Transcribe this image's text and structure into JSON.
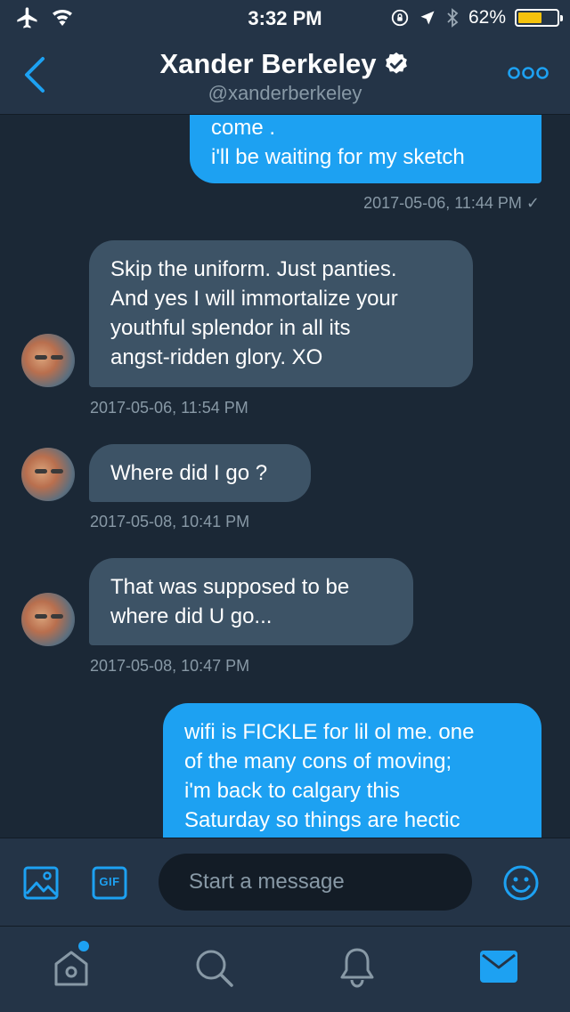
{
  "status_bar": {
    "time": "3:32 PM",
    "battery_percent": "62%",
    "battery_level": 0.62,
    "battery_color": "#f4c20d"
  },
  "header": {
    "name": "Xander Berkeley",
    "handle": "@xanderberkeley",
    "verified": true
  },
  "messages": [
    {
      "direction": "outgoing",
      "text": "come .\ni'll be waiting for my sketch",
      "timestamp": "2017-05-06, 11:44 PM ✓"
    },
    {
      "direction": "incoming",
      "text": "Skip the uniform. Just panties.\nAnd yes I will immortalize your\nyouthful splendor in all its\nangst-ridden glory. XO",
      "timestamp": "2017-05-06, 11:54 PM"
    },
    {
      "direction": "incoming",
      "text": "Where did I go ?",
      "timestamp": "2017-05-08, 10:41 PM"
    },
    {
      "direction": "incoming",
      "text": "That was supposed to be\nwhere did U go...",
      "timestamp": "2017-05-08, 10:47 PM"
    },
    {
      "direction": "outgoing",
      "text": "wifi is FICKLE for lil ol me. one\nof the many cons of moving;\ni'm back to calgary this\nSaturday so things are hectic",
      "timestamp": ""
    }
  ],
  "composer": {
    "placeholder": "Start a message",
    "gif_label": "GIF",
    "icons": [
      "image-icon",
      "gif-icon",
      "emoji-icon"
    ]
  },
  "tab_bar": {
    "tabs": [
      "home",
      "search",
      "notifications",
      "messages"
    ],
    "active": "messages",
    "home_has_badge": true
  },
  "colors": {
    "accent": "#1da1f2",
    "background": "#1b2836",
    "panel": "#243447",
    "incoming_bubble": "#3d5366",
    "muted": "#8899a6"
  }
}
